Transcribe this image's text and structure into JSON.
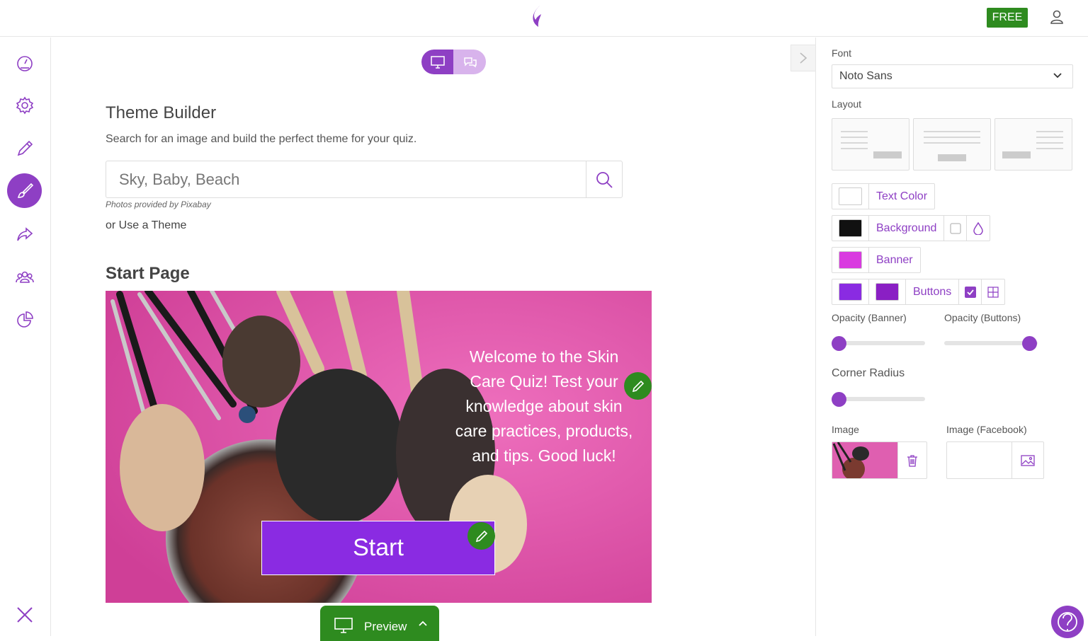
{
  "header": {
    "badge": "FREE"
  },
  "sidebar": {
    "items": [
      {
        "name": "dashboard"
      },
      {
        "name": "settings"
      },
      {
        "name": "edit"
      },
      {
        "name": "design",
        "active": true
      },
      {
        "name": "share"
      },
      {
        "name": "audience"
      },
      {
        "name": "reports"
      }
    ]
  },
  "main": {
    "theme_title": "Theme Builder",
    "theme_subtitle": "Search for an image and build the perfect theme for your quiz.",
    "search_placeholder": "Sky, Baby, Beach",
    "photo_credit": "Photos provided by Pixabay",
    "use_theme": "or Use a Theme",
    "start_page_title": "Start Page",
    "welcome_text": "Welcome to the Skin Care Quiz! Test your knowledge about skin care practices, products, and tips. Good luck!",
    "start_label": "Start",
    "preview_label": "Preview"
  },
  "panel": {
    "font_label": "Font",
    "font_value": "Noto Sans",
    "layout_label": "Layout",
    "text_color_label": "Text Color",
    "background_label": "Background",
    "banner_label": "Banner",
    "buttons_label": "Buttons",
    "opacity_banner_label": "Opacity (Banner)",
    "opacity_buttons_label": "Opacity (Buttons)",
    "corner_radius_label": "Corner Radius",
    "image_label": "Image",
    "image_facebook_label": "Image (Facebook)",
    "opacity_banner_value": 0,
    "opacity_buttons_value": 1,
    "corner_radius_value": 0
  },
  "colors": {
    "accent": "#8e3fc4",
    "green": "#2e8b1f",
    "text_color": "#ffffff",
    "background_color": "#111111",
    "banner_color": "#d93ae0",
    "button_color_1": "#8a2be2",
    "button_color_2": "#8a1fc4"
  }
}
